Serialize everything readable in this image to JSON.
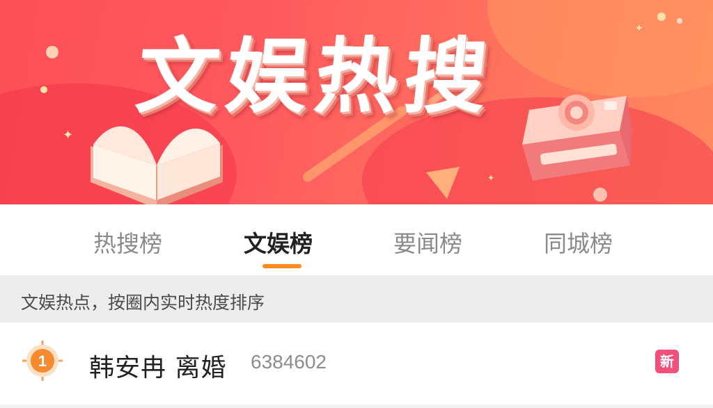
{
  "banner": {
    "title": "文娱热搜"
  },
  "tabs": [
    {
      "label": "热搜榜",
      "active": false
    },
    {
      "label": "文娱榜",
      "active": true
    },
    {
      "label": "要闻榜",
      "active": false
    },
    {
      "label": "同城榜",
      "active": false
    }
  ],
  "notice": {
    "text": "文娱热点，按圈内实时热度排序"
  },
  "list": [
    {
      "rank": "1",
      "title": "韩安冉 离婚",
      "count": "6384602",
      "badge": "新"
    }
  ],
  "colors": {
    "banner_red": "#ff5a5f",
    "tab_indicator": "#ff8a1f",
    "rank_badge": "#f58a2e",
    "new_badge": "#f24f7a",
    "notice_bg": "#ededed"
  },
  "icons": {
    "rank": "rank-medal-icon",
    "new": "new-tag-icon",
    "book": "open-book-icon",
    "camera": "instant-camera-icon"
  }
}
